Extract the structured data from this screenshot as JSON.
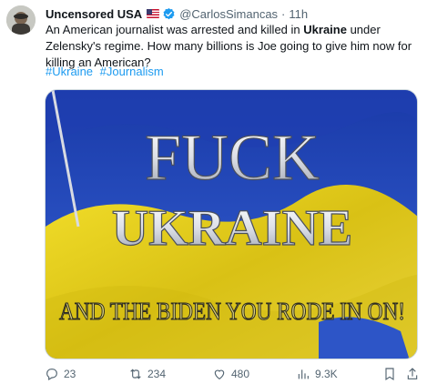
{
  "author": {
    "display_name": "Uncensored USA",
    "flag_emoji": "🇺🇸",
    "handle": "@CarlosSimancas",
    "separator": "·",
    "time": "11h"
  },
  "post": {
    "text_part1": "An American journalist was arrested and killed in ",
    "text_bold": "Ukraine",
    "text_part2": " under Zelensky's regime.  How many billions is Joe going to give him now for killing an American?",
    "hashtags": [
      "#Ukraine",
      "#Journalism"
    ]
  },
  "media": {
    "line1": "FUCK",
    "line2": "UKRAINE",
    "line3": "AND THE BIDEN YOU RODE IN ON!",
    "colors": {
      "blue": "#2a4fc4",
      "yellow": "#e9d219"
    }
  },
  "actions": {
    "replies": "23",
    "reposts": "234",
    "likes": "480",
    "views": "9.3K"
  },
  "icons": [
    "reply-icon",
    "repost-icon",
    "like-icon",
    "views-icon",
    "bookmark-icon",
    "share-icon",
    "verified-icon"
  ]
}
